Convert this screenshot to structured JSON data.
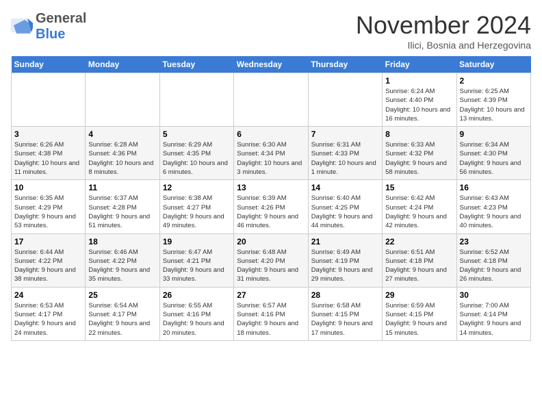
{
  "header": {
    "logo_general": "General",
    "logo_blue": "Blue",
    "month_title": "November 2024",
    "location": "Ilici, Bosnia and Herzegovina"
  },
  "weekdays": [
    "Sunday",
    "Monday",
    "Tuesday",
    "Wednesday",
    "Thursday",
    "Friday",
    "Saturday"
  ],
  "weeks": [
    [
      {
        "num": "",
        "info": ""
      },
      {
        "num": "",
        "info": ""
      },
      {
        "num": "",
        "info": ""
      },
      {
        "num": "",
        "info": ""
      },
      {
        "num": "",
        "info": ""
      },
      {
        "num": "1",
        "info": "Sunrise: 6:24 AM\nSunset: 4:40 PM\nDaylight: 10 hours and 16 minutes."
      },
      {
        "num": "2",
        "info": "Sunrise: 6:25 AM\nSunset: 4:39 PM\nDaylight: 10 hours and 13 minutes."
      }
    ],
    [
      {
        "num": "3",
        "info": "Sunrise: 6:26 AM\nSunset: 4:38 PM\nDaylight: 10 hours and 11 minutes."
      },
      {
        "num": "4",
        "info": "Sunrise: 6:28 AM\nSunset: 4:36 PM\nDaylight: 10 hours and 8 minutes."
      },
      {
        "num": "5",
        "info": "Sunrise: 6:29 AM\nSunset: 4:35 PM\nDaylight: 10 hours and 6 minutes."
      },
      {
        "num": "6",
        "info": "Sunrise: 6:30 AM\nSunset: 4:34 PM\nDaylight: 10 hours and 3 minutes."
      },
      {
        "num": "7",
        "info": "Sunrise: 6:31 AM\nSunset: 4:33 PM\nDaylight: 10 hours and 1 minute."
      },
      {
        "num": "8",
        "info": "Sunrise: 6:33 AM\nSunset: 4:32 PM\nDaylight: 9 hours and 58 minutes."
      },
      {
        "num": "9",
        "info": "Sunrise: 6:34 AM\nSunset: 4:30 PM\nDaylight: 9 hours and 56 minutes."
      }
    ],
    [
      {
        "num": "10",
        "info": "Sunrise: 6:35 AM\nSunset: 4:29 PM\nDaylight: 9 hours and 53 minutes."
      },
      {
        "num": "11",
        "info": "Sunrise: 6:37 AM\nSunset: 4:28 PM\nDaylight: 9 hours and 51 minutes."
      },
      {
        "num": "12",
        "info": "Sunrise: 6:38 AM\nSunset: 4:27 PM\nDaylight: 9 hours and 49 minutes."
      },
      {
        "num": "13",
        "info": "Sunrise: 6:39 AM\nSunset: 4:26 PM\nDaylight: 9 hours and 46 minutes."
      },
      {
        "num": "14",
        "info": "Sunrise: 6:40 AM\nSunset: 4:25 PM\nDaylight: 9 hours and 44 minutes."
      },
      {
        "num": "15",
        "info": "Sunrise: 6:42 AM\nSunset: 4:24 PM\nDaylight: 9 hours and 42 minutes."
      },
      {
        "num": "16",
        "info": "Sunrise: 6:43 AM\nSunset: 4:23 PM\nDaylight: 9 hours and 40 minutes."
      }
    ],
    [
      {
        "num": "17",
        "info": "Sunrise: 6:44 AM\nSunset: 4:22 PM\nDaylight: 9 hours and 38 minutes."
      },
      {
        "num": "18",
        "info": "Sunrise: 6:46 AM\nSunset: 4:22 PM\nDaylight: 9 hours and 35 minutes."
      },
      {
        "num": "19",
        "info": "Sunrise: 6:47 AM\nSunset: 4:21 PM\nDaylight: 9 hours and 33 minutes."
      },
      {
        "num": "20",
        "info": "Sunrise: 6:48 AM\nSunset: 4:20 PM\nDaylight: 9 hours and 31 minutes."
      },
      {
        "num": "21",
        "info": "Sunrise: 6:49 AM\nSunset: 4:19 PM\nDaylight: 9 hours and 29 minutes."
      },
      {
        "num": "22",
        "info": "Sunrise: 6:51 AM\nSunset: 4:18 PM\nDaylight: 9 hours and 27 minutes."
      },
      {
        "num": "23",
        "info": "Sunrise: 6:52 AM\nSunset: 4:18 PM\nDaylight: 9 hours and 26 minutes."
      }
    ],
    [
      {
        "num": "24",
        "info": "Sunrise: 6:53 AM\nSunset: 4:17 PM\nDaylight: 9 hours and 24 minutes."
      },
      {
        "num": "25",
        "info": "Sunrise: 6:54 AM\nSunset: 4:17 PM\nDaylight: 9 hours and 22 minutes."
      },
      {
        "num": "26",
        "info": "Sunrise: 6:55 AM\nSunset: 4:16 PM\nDaylight: 9 hours and 20 minutes."
      },
      {
        "num": "27",
        "info": "Sunrise: 6:57 AM\nSunset: 4:16 PM\nDaylight: 9 hours and 18 minutes."
      },
      {
        "num": "28",
        "info": "Sunrise: 6:58 AM\nSunset: 4:15 PM\nDaylight: 9 hours and 17 minutes."
      },
      {
        "num": "29",
        "info": "Sunrise: 6:59 AM\nSunset: 4:15 PM\nDaylight: 9 hours and 15 minutes."
      },
      {
        "num": "30",
        "info": "Sunrise: 7:00 AM\nSunset: 4:14 PM\nDaylight: 9 hours and 14 minutes."
      }
    ]
  ]
}
